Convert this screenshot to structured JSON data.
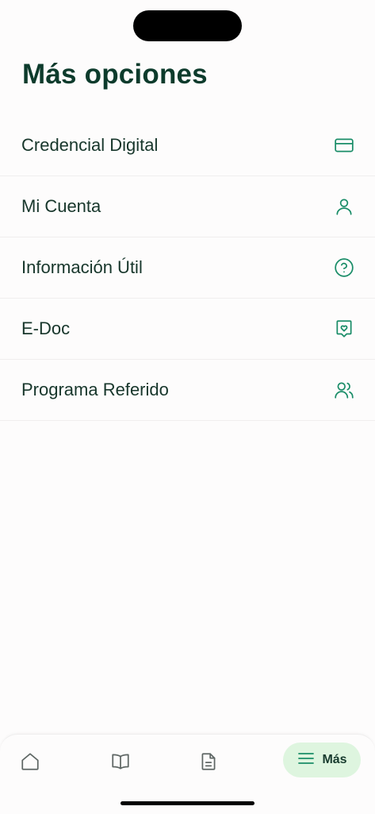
{
  "header": {
    "title": "Más opciones"
  },
  "menu": {
    "items": [
      {
        "label": "Credencial Digital",
        "icon": "credit-card-icon"
      },
      {
        "label": "Mi Cuenta",
        "icon": "user-icon"
      },
      {
        "label": "Información Útil",
        "icon": "help-circle-icon"
      },
      {
        "label": "E-Doc",
        "icon": "heart-document-icon"
      },
      {
        "label": "Programa Referido",
        "icon": "users-icon"
      }
    ]
  },
  "tabbar": {
    "tabs": [
      {
        "icon": "home-icon"
      },
      {
        "icon": "book-icon"
      },
      {
        "icon": "document-icon"
      },
      {
        "icon": "menu-icon",
        "label": "Más",
        "active": true
      }
    ]
  },
  "colors": {
    "accent": "#1a8d68",
    "title": "#0d3b2c",
    "active_tab_bg": "#def5df",
    "background": "#fdfcfc"
  }
}
